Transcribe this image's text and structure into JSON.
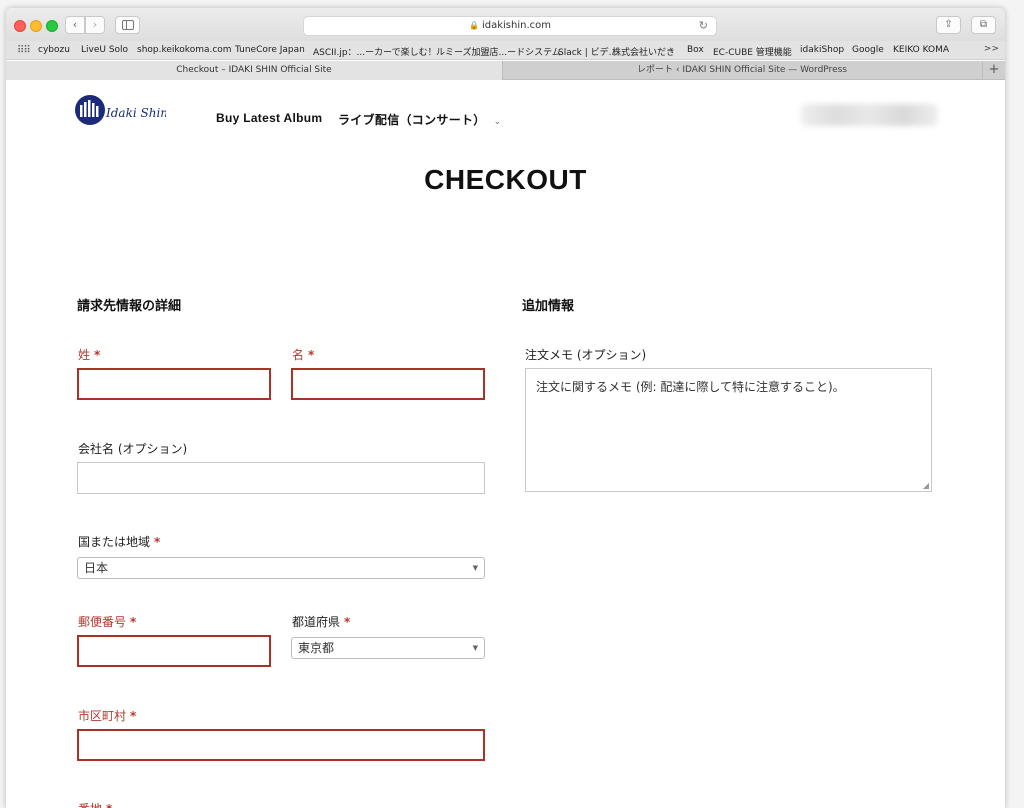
{
  "browser": {
    "url": "idakishin.com",
    "bookmarks": [
      "cybozu",
      "LiveU Solo",
      "shop.keikokoma.com",
      "TuneCore Japan",
      "ASCII.jp：...ーカーで楽しむ！",
      "ルミーズ加盟店...ードシステム",
      "Slack | ビデ...",
      "株式会社いだき",
      "Box",
      "EC-CUBE 管理機能",
      "idakiShop",
      "Google",
      "KEIKO KOMA"
    ],
    "bookmarks_more": ">>",
    "tabs": [
      {
        "label": "Checkout – IDAKI SHIN Official Site",
        "active": true
      },
      {
        "label": "レポート ‹ IDAKI SHIN Official Site — WordPress",
        "active": false
      }
    ],
    "new_tab": "+"
  },
  "site": {
    "logo_text": "Idaki Shin",
    "nav": [
      {
        "label": "Buy Latest Album"
      },
      {
        "label": "ライブ配信（コンサート）",
        "has_dropdown": true
      }
    ]
  },
  "page": {
    "title": "CHECKOUT"
  },
  "billing": {
    "heading": "請求先情報の詳細",
    "last_name_label": "姓",
    "first_name_label": "名",
    "company_label": "会社名 (オプション)",
    "country_label": "国または地域",
    "country_value": "日本",
    "postcode_label": "郵便番号",
    "prefecture_label": "都道府県",
    "prefecture_value": "東京都",
    "city_label": "市区町村",
    "address_label": "番地",
    "required_mark": "*"
  },
  "additional": {
    "heading": "追加情報",
    "notes_label": "注文メモ (オプション)",
    "notes_placeholder": "注文に関するメモ (例: 配達に際して特に注意すること)。"
  },
  "colors": {
    "error": "#a83228",
    "brand_navy": "#1b2a7a"
  }
}
